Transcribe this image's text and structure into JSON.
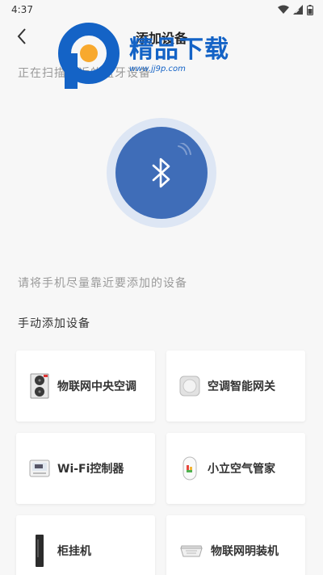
{
  "status_bar": {
    "time": "4:37"
  },
  "header": {
    "title": "添加设备"
  },
  "scan_text": "正在扫描附近的蓝牙设备",
  "hint_text": "请将手机尽量靠近要添加的设备",
  "manual_title": "手动添加设备",
  "devices": [
    {
      "label": "物联网中央空调",
      "icon": "hvac-outdoor-unit-icon"
    },
    {
      "label": "空调智能网关",
      "icon": "smart-gateway-icon"
    },
    {
      "label": "Wi-Fi控制器",
      "icon": "wifi-thermostat-icon"
    },
    {
      "label": "小立空气管家",
      "icon": "air-monitor-icon"
    },
    {
      "label": "柜挂机",
      "icon": "tower-ac-icon"
    },
    {
      "label": "物联网明装机",
      "icon": "ceiling-cassette-icon"
    }
  ],
  "watermark": {
    "text": "精品下载",
    "url": "www.jj9p.com"
  },
  "colors": {
    "accent": "#3f6db8",
    "ring": "#dde6f4",
    "watermark": "#1463c6"
  }
}
